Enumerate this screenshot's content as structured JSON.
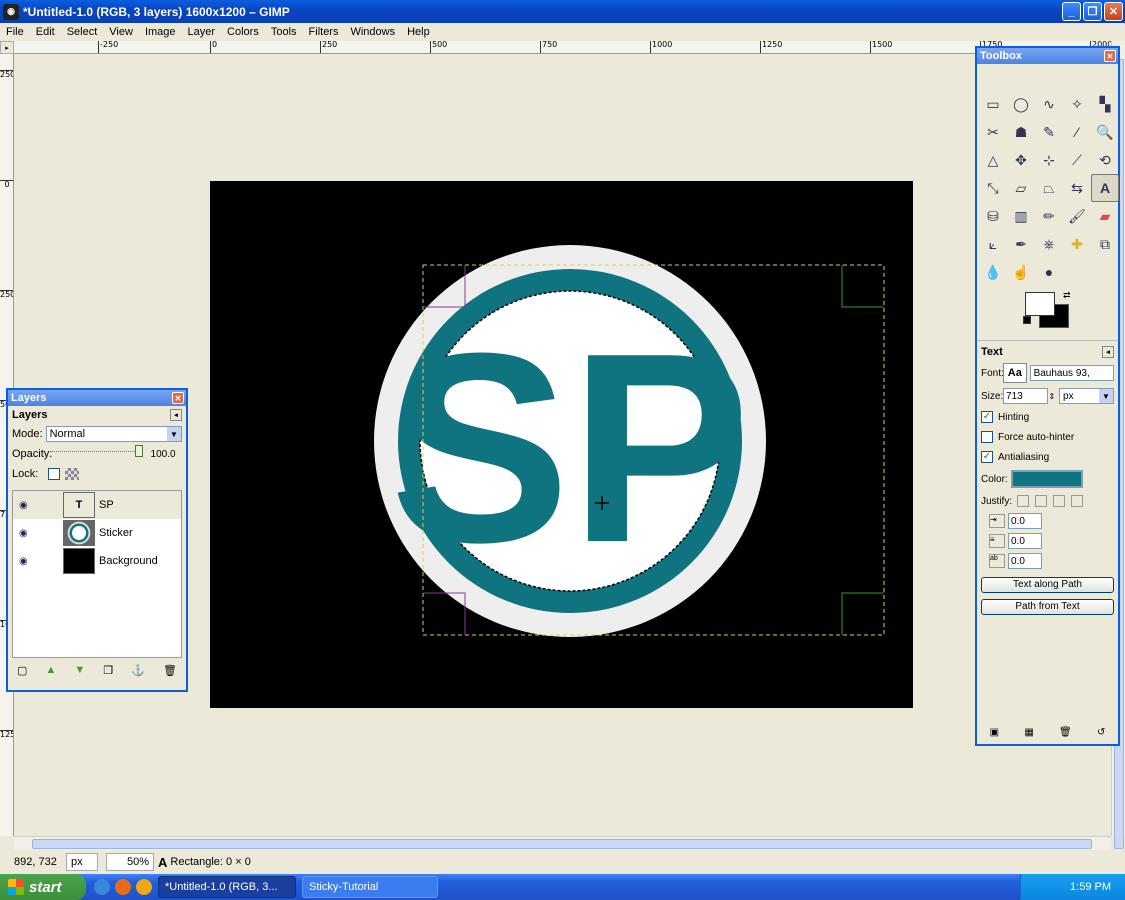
{
  "window": {
    "title": "*Untitled-1.0 (RGB, 3 layers) 1600x1200 – GIMP",
    "minimize": "_",
    "maximize": "❐",
    "close": "✕"
  },
  "menu": [
    "File",
    "Edit",
    "Select",
    "View",
    "Image",
    "Layer",
    "Colors",
    "Tools",
    "Filters",
    "Windows",
    "Help"
  ],
  "hruler": [
    "-250",
    "0",
    "250",
    "500",
    "750",
    "1000",
    "1250",
    "1500",
    "1750",
    "2000"
  ],
  "vruler": [
    "250",
    "0",
    "250",
    "500",
    "750",
    "1000",
    "1250"
  ],
  "canvas": {
    "logo_text": "SP",
    "accent_color": "#0f7480",
    "ring_color": "#eeeeee"
  },
  "layers": {
    "dock_title": "Layers",
    "panel_title": "Layers",
    "mode_label": "Mode:",
    "mode_value": "Normal",
    "opacity_label": "Opacity:",
    "opacity_value": "100.0",
    "lock_label": "Lock:",
    "items": [
      {
        "name": "SP"
      },
      {
        "name": "Sticker"
      },
      {
        "name": "Background"
      }
    ]
  },
  "toolbox": {
    "title": "Toolbox",
    "text_options": {
      "title": "Text",
      "font_label": "Font:",
      "font_value": "Bauhaus 93,",
      "font_preview": "Aa",
      "size_label": "Size:",
      "size_value": "713",
      "size_unit": "px",
      "hinting": "Hinting",
      "force_autohinter": "Force auto-hinter",
      "antialiasing": "Antialiasing",
      "color_label": "Color:",
      "color_value": "#0f7480",
      "justify_label": "Justify:",
      "indent_value": "0.0",
      "line_spacing_value": "0.0",
      "letter_spacing_value": "0.0",
      "text_along_path": "Text along Path",
      "path_from_text": "Path from Text"
    }
  },
  "status": {
    "coords": "892, 732",
    "unit": "px",
    "zoom": "50%",
    "message": "Rectangle: 0 × 0"
  },
  "taskbar": {
    "start": "start",
    "tasks": [
      "*Untitled-1.0 (RGB, 3...",
      "Sticky-Tutorial"
    ],
    "clock": "1:59 PM"
  }
}
